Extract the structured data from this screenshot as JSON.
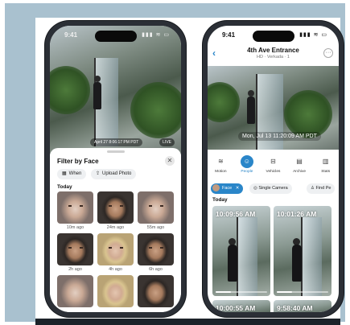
{
  "left_phone": {
    "status": {
      "time": "9:41",
      "icons": "▮▮▮ ≋ ▭"
    },
    "video": {
      "timestamp": "April 27 8:06:17 PM PDT",
      "live_label": "LIVE"
    },
    "sheet": {
      "title": "Filter by Face",
      "chips": [
        {
          "label": "When",
          "icon": "calendar-icon"
        },
        {
          "label": "Upload Photo",
          "icon": "upload-photo-icon"
        }
      ],
      "section": "Today",
      "faces": [
        {
          "label": "10m ago",
          "tone": "pale"
        },
        {
          "label": "24m ago",
          "tone": "dark"
        },
        {
          "label": "55m ago",
          "tone": "pale"
        },
        {
          "label": "2h ago",
          "tone": "dark"
        },
        {
          "label": "4h ago",
          "tone": "blond"
        },
        {
          "label": "6h ago",
          "tone": "dark"
        }
      ]
    }
  },
  "right_phone": {
    "status": {
      "time": "9:41",
      "icons": "▮▮▮ ≋ ▭"
    },
    "header": {
      "title": "4th Ave Entrance",
      "subtitle": "HD · Verkada · 1"
    },
    "video": {
      "timestamp": "Mon, Jul 13  11:20:09 AM PDT"
    },
    "tools": [
      {
        "label": "Motion",
        "icon": "motion-icon",
        "glyph": "≋",
        "active": false
      },
      {
        "label": "People",
        "icon": "people-icon",
        "glyph": "☺",
        "active": true
      },
      {
        "label": "Vehicles",
        "icon": "vehicle-icon",
        "glyph": "⊟",
        "active": false
      },
      {
        "label": "Archive",
        "icon": "archive-icon",
        "glyph": "▤",
        "active": false
      },
      {
        "label": "Stats",
        "icon": "stats-icon",
        "glyph": "▥",
        "active": false
      }
    ],
    "filters": {
      "face": "Face",
      "face_close": "✕",
      "single_camera": "Single Camera",
      "find": "Find Pe"
    },
    "section": "Today",
    "clips": [
      {
        "time": "10:09:56 AM",
        "progress": 0.3
      },
      {
        "time": "10:01:26 AM",
        "progress": 0.3
      },
      {
        "time": "10:00:55 AM",
        "progress": 0.3
      },
      {
        "time": "9:58:40 AM",
        "progress": 0.3
      }
    ]
  },
  "colors": {
    "accent": "#2a86c9",
    "backdrop": "#a9c1cf"
  }
}
